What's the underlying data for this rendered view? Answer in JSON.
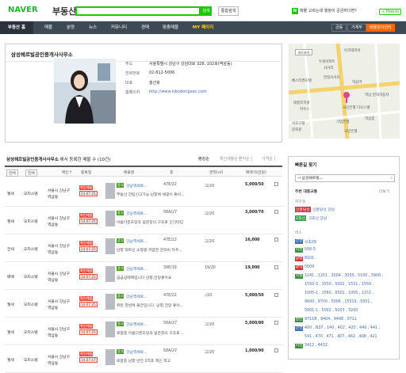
{
  "header": {
    "logo": "NAVER",
    "brand": "부동산",
    "search_button": "검색",
    "combined_search": "통합검색",
    "promo_badge": "N",
    "promo_text": "매물 고르는데 행정이 궁금하다면?",
    "mobile": "+ Mobile"
  },
  "nav": {
    "items": [
      "부동산 홈",
      "매물",
      "분양",
      "뉴스",
      "커뮤니티",
      "경매",
      "맞춤매물",
      "MY 페이지"
    ],
    "right": [
      "금융",
      "가계부",
      "매물관리센터"
    ]
  },
  "agent": {
    "name": "삼성쉐르빌공인중개사사무소",
    "rows": [
      {
        "k": "주소",
        "v": "서울특별시 강남구 강남대로 328, 102호(역삼동)"
      },
      {
        "k": "전화번호",
        "v": "02-812-5006"
      },
      {
        "k": "대표",
        "v": "홍선화"
      },
      {
        "k": "홈페이지",
        "v": "http://www.isbudongsan.com"
      }
    ]
  },
  "map": {
    "button": "지도보기",
    "labels": [
      "아크테리아",
      "우성아파트",
      "사거리",
      "베스티켄호텔",
      "역삼역",
      "한일사거리",
      "데름프지플",
      "하우스",
      "국민은행 디오스텔",
      "역삼 현대자동차",
      "기업은행",
      "서초구청",
      "문화원",
      "역삼중",
      "국민은행"
    ]
  },
  "listings_header": {
    "title": "삼성쉐르빌공인중개사사무소",
    "suffix": " 에서 등록한 매물 수 (10건)",
    "sorts": [
      "랭킹순",
      "확인매물순 | ",
      "면적순 | ",
      "가격순 |"
    ]
  },
  "filters": {
    "deal": "전체",
    "type": "전체",
    "cols": [
      "매물명",
      "층",
      "면적(㎡)",
      "매매가(만원)"
    ],
    "extra": [
      "확인↑",
      "등록일"
    ]
  },
  "listings": [
    {
      "deal": "월세",
      "type": "오피스텔",
      "addr1": "서울시 강남구",
      "addr2": "역삼동",
      "badge": "확인매물",
      "date": "14.07.25",
      "tag": "광고",
      "title": "강남역세로...",
      "desc": "부동산 전입신고가능 남향에 채광이 좋아...",
      "size": "47E/22",
      "floor": "고/20",
      "price": "5,000/50"
    },
    {
      "deal": "월세",
      "type": "오피스텔",
      "addr1": "서울시 강남구",
      "addr2": "역삼동",
      "badge": "확인매물",
      "date": "14.07.25",
      "tag": "광고",
      "title": "강남역세로...",
      "desc": "아름다운조망과 넓은창의 구조로 인기타입",
      "size": "58A/27",
      "floor": "고/20",
      "price": "3,000/70"
    },
    {
      "deal": "전세",
      "type": "오피스텔",
      "addr1": "서울시 강남구",
      "addr2": "역삼동",
      "badge": "확인매물",
      "date": "14.07.25",
      "tag": "광고",
      "title": "강남역세로...",
      "desc": "남향 탁트인 소형평 저렴한 관리비 자주...",
      "size": "47E/22",
      "floor": "고/20",
      "price": "16,000"
    },
    {
      "deal": "매매",
      "type": "오피스텔",
      "addr1": "서울시 강남구",
      "addr2": "역삼동",
      "badge": "확인매물",
      "date": "14.07.25",
      "tag": "광고",
      "title": "강남역세로...",
      "desc": "급급급매매입니다 남향,전망좋아요",
      "size": "39E/19",
      "floor": "19/20",
      "price": "19,000"
    },
    {
      "deal": "월세",
      "type": "오피스텔",
      "addr1": "서울시 강남구",
      "addr2": "역삼동",
      "badge": "확인매물",
      "date": "14.07.25",
      "tag": "광고",
      "title": "강남역세로...",
      "desc": "위탄 한번에 풀컨입니다. 남향,전망 좋아...",
      "size": "47E/22",
      "floor": "-/20",
      "price": "5,000/50"
    },
    {
      "deal": "월세",
      "type": "오피스텔",
      "addr1": "서울시 강남구",
      "addr2": "역삼동",
      "badge": "확인매물",
      "date": "14.07.25",
      "tag": "광고",
      "title": "강남역세로...",
      "desc": "로얄층 아름다운조망과 넓은창의 구조로 ...",
      "size": "58A/27",
      "floor": "고/20",
      "price": "5,000/80"
    },
    {
      "deal": "월세",
      "type": "오피스텔",
      "addr1": "서울시 강남구",
      "addr2": "역삼동",
      "badge": "확인매물",
      "date": "14.07.17",
      "tag": "광고",
      "title": "강남역세로...",
      "desc": "로얄층 남향 반전 1억호 해인 최고",
      "size": "58A/27",
      "floor": "고/20",
      "price": "1,000/90"
    }
  ],
  "panel": {
    "title": "빠른길 찾기",
    "search_value": "→ 삼성쉐르빌...",
    "sub": "주변 대중교통",
    "more": "더보기",
    "subway_label": "지하철",
    "subway": [
      {
        "line": "신분당선",
        "name": "신분당선 강남"
      },
      {
        "line": "2호선",
        "name": "2호선 강남"
      }
    ],
    "bus_label": "버스",
    "bus": [
      {
        "type": "간선",
        "routes": "서초09"
      },
      {
        "type": "지선",
        "routes": "500-5"
      },
      {
        "type": "급행",
        "routes": "8101"
      },
      {
        "type": "광역",
        "routes": "5009"
      },
      {
        "type": "직행",
        "routes": "1241 , 1251 , 3004 , 3030 , 5100 , 3900 ,"
      },
      {
        "type": "",
        "routes": "1550-3 , 1550 , 5002 , 1551 , 1550 ,"
      },
      {
        "type": "",
        "routes": "1005-1 , 1560 , 6501 , 1005 , 1151 ,"
      },
      {
        "type": "",
        "routes": "9600 , 9700 , 5006 , 15519 , 5001 ,"
      },
      {
        "type": "",
        "routes": "5001-1 , 5002 , 5003 , 3200"
      },
      {
        "type": "일반",
        "routes": "9711B , 9404 , 9408 , 9711"
      },
      {
        "type": "간선",
        "routes": "400 , N37 , 140 , 402 , 420 , 440 , 441 ,"
      },
      {
        "type": "",
        "routes": "541 , 470 , 471 , 407 , 462 , 408 , 421"
      },
      {
        "type": "지선",
        "routes": "3412 , 4432"
      }
    ]
  },
  "colors": {
    "naver_green": "#1ec800",
    "nav_bg": "#3d4a55",
    "accent_orange": "#ff6600",
    "badge_red": "#e94b3c",
    "link_blue": "#3e6eb4",
    "my_yellow": "#ffd400"
  }
}
